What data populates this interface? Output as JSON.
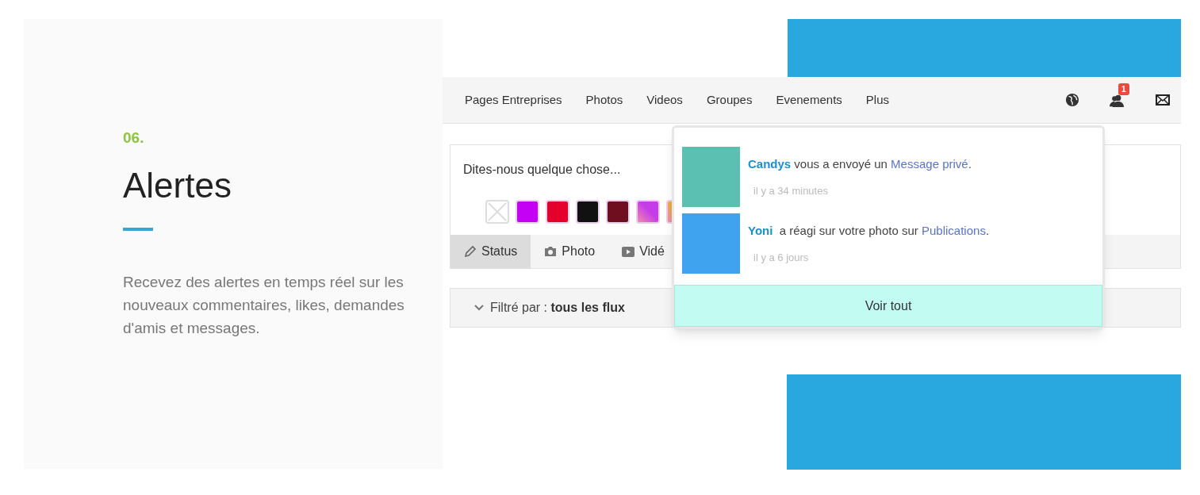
{
  "feature": {
    "number": "06.",
    "title": "Alertes",
    "description": "Recevez des alertes en temps réel sur les nouveaux commentaires, likes, demandes d'amis et messages."
  },
  "nav": {
    "links": [
      "Pages Entreprises",
      "Photos",
      "Videos",
      "Groupes",
      "Evenements",
      "Plus"
    ],
    "badge": "1"
  },
  "composer": {
    "placeholder": "Dites-nous quelque chose...",
    "swatches": [
      {
        "kind": "none"
      },
      {
        "kind": "color",
        "color": "#c400f5"
      },
      {
        "kind": "color",
        "color": "#e4002b"
      },
      {
        "kind": "color",
        "color": "#111111"
      },
      {
        "kind": "color",
        "color": "#6e0f20"
      },
      {
        "kind": "gradient",
        "color": "#c63ce8"
      },
      {
        "kind": "gradient",
        "color": "#f0b030"
      }
    ],
    "tabs": [
      {
        "label": "Status",
        "selected": true
      },
      {
        "label": "Photo",
        "selected": false
      },
      {
        "label": "Vidé",
        "selected": false
      }
    ]
  },
  "filter": {
    "label": "Filtré par :",
    "value": "tous les flux"
  },
  "notifications": {
    "items": [
      {
        "name": "Candys",
        "text": " vous a envoyé un ",
        "link": "Message privé",
        "end": ".",
        "time": "il y a 34 minutes",
        "color": "#5bbfb2"
      },
      {
        "name": "Yoni",
        "text": "  a réagi sur votre photo sur ",
        "link": "Publications",
        "end": ".",
        "time": "il y a 6 jours",
        "color": "#3fa3f0"
      }
    ],
    "footer": "Voir tout"
  }
}
